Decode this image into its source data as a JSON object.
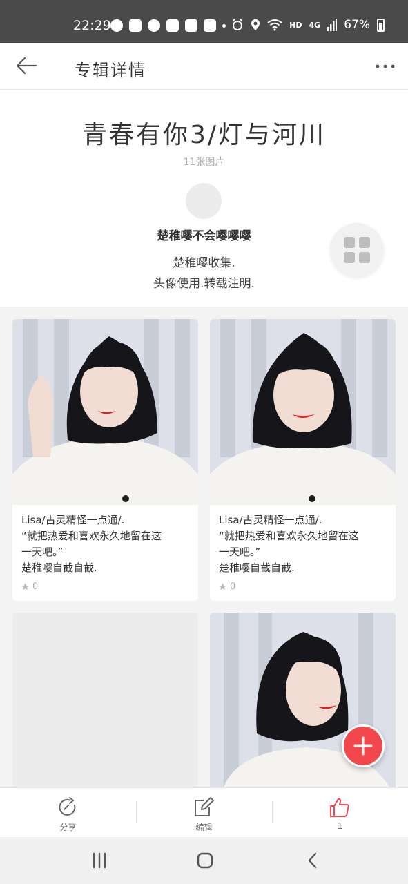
{
  "status_bar": {
    "time": "22:29",
    "network": "HD",
    "signal": "4G",
    "battery": "67%",
    "icons": [
      "globe-icon",
      "paw-app-icon",
      "send-icon",
      "paw-app-icon",
      "paw-app-icon",
      "paw-app-icon",
      "alarm-icon",
      "location-icon",
      "wifi-icon",
      "signal-icon",
      "battery-icon"
    ]
  },
  "header": {
    "title": "专辑详情",
    "back_icon": "back-arrow-icon",
    "more_icon": "more-icon"
  },
  "album": {
    "title": "青春有你3/灯与河川",
    "photo_count": "11张图片",
    "author": "楚稚嘤不会嘤嘤嘤",
    "description_line1": "楚稚嘤收集.",
    "description_line2": "头像使用.转载注明."
  },
  "cards": [
    {
      "caption_lines": [
        "Lisa/古灵精怪一点通/.",
        "“就把热爱和喜欢永久地留在这",
        "一天吧。”",
        "楚稚嘤自截自截."
      ],
      "likes": "0"
    },
    {
      "caption_lines": [
        "Lisa/古灵精怪一点通/.",
        "“就把热爱和喜欢永久地留在这",
        "一天吧。”",
        "楚稚嘤自截自截."
      ],
      "likes": "0"
    }
  ],
  "toolbar": {
    "share_label": "分享",
    "edit_label": "编辑",
    "like_count": "1"
  },
  "colors": {
    "accent_red": "#f2484d",
    "status_bar": "#4a4a4a",
    "lipstick": "#d4262a"
  }
}
